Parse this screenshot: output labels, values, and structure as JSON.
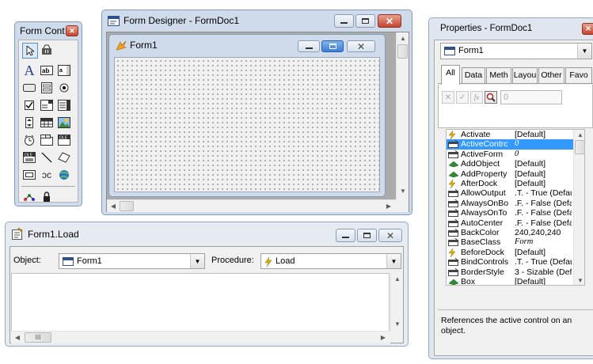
{
  "toolbox": {
    "title": "Form Cont",
    "tools": [
      "pointer-icon",
      "builder-lock-icon",
      "label-icon",
      "textbox-icon",
      "editbox-icon",
      "command-button-icon",
      "command-group-icon",
      "option-group-icon",
      "checkbox-icon",
      "combobox-icon",
      "listbox-icon",
      "spinner-icon",
      "grid-icon",
      "image-icon",
      "timer-icon",
      "pageframe-icon",
      "oleboundcontrol-icon",
      "olecontainer-icon",
      "line-icon",
      "shape-icon",
      "container-icon",
      "separator-icon",
      "hyperlink-icon",
      "view-classes-icon",
      "lock-icon"
    ]
  },
  "form_designer": {
    "title": "Form Designer - FormDoc1",
    "form": {
      "title": "Form1"
    }
  },
  "code_window": {
    "title": "Form1.Load",
    "object_label": "Object:",
    "object_value": "Form1",
    "procedure_label": "Procedure:",
    "procedure_value": "Load",
    "hscroll_thumb": "III"
  },
  "properties": {
    "title": "Properties - FormDoc1",
    "object_combo": "Form1",
    "tabs": [
      "All",
      "Data",
      "Meth",
      "Layou",
      "Other",
      "Favo"
    ],
    "active_tab": "All",
    "value_box": "0",
    "rows": [
      {
        "name": "Activate",
        "value": "[Default]",
        "kind": "event"
      },
      {
        "name": "ActiveContrc",
        "value": "0",
        "kind": "prop",
        "italic": true,
        "selected": true
      },
      {
        "name": "ActiveForm",
        "value": "0",
        "kind": "prop",
        "italic": true
      },
      {
        "name": "AddObject",
        "value": "[Default]",
        "kind": "method"
      },
      {
        "name": "AddProperty",
        "value": "[Default]",
        "kind": "method"
      },
      {
        "name": "AfterDock",
        "value": "[Default]",
        "kind": "event"
      },
      {
        "name": "AllowOutput",
        "value": ".T. - True (Defau",
        "kind": "prop"
      },
      {
        "name": "AlwaysOnBo",
        "value": ".F. - False (Defa",
        "kind": "prop"
      },
      {
        "name": "AlwaysOnTo",
        "value": ".F. - False (Defa",
        "kind": "prop"
      },
      {
        "name": "AutoCenter",
        "value": ".F. - False (Defa",
        "kind": "prop"
      },
      {
        "name": "BackColor",
        "value": "240,240,240",
        "kind": "prop"
      },
      {
        "name": "BaseClass",
        "value": "Form",
        "kind": "prop",
        "italic": true
      },
      {
        "name": "BeforeDock",
        "value": "[Default]",
        "kind": "event"
      },
      {
        "name": "BindControls",
        "value": ".T. - True (Defau",
        "kind": "prop"
      },
      {
        "name": "BorderStyle",
        "value": "3 - Sizable (Defa",
        "kind": "prop"
      },
      {
        "name": "Box",
        "value": "[Default]",
        "kind": "method"
      }
    ],
    "description": "References the active control on an object."
  },
  "colors": {
    "selection": "#3399ff",
    "event_icon": "#e0b000",
    "method_icon": "#2e8b2e",
    "close": "#c5452d"
  }
}
